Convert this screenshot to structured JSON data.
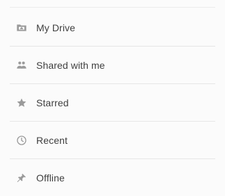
{
  "nav": {
    "items": [
      {
        "label": "My Drive",
        "icon": "folder-icon"
      },
      {
        "label": "Shared with me",
        "icon": "people-icon"
      },
      {
        "label": "Starred",
        "icon": "star-icon"
      },
      {
        "label": "Recent",
        "icon": "clock-icon"
      },
      {
        "label": "Offline",
        "icon": "pin-icon"
      }
    ]
  },
  "colors": {
    "icon": "#9a9a9a",
    "text": "#3f3f3f",
    "divider": "#e6e6e6",
    "background": "#fbfbfb"
  }
}
